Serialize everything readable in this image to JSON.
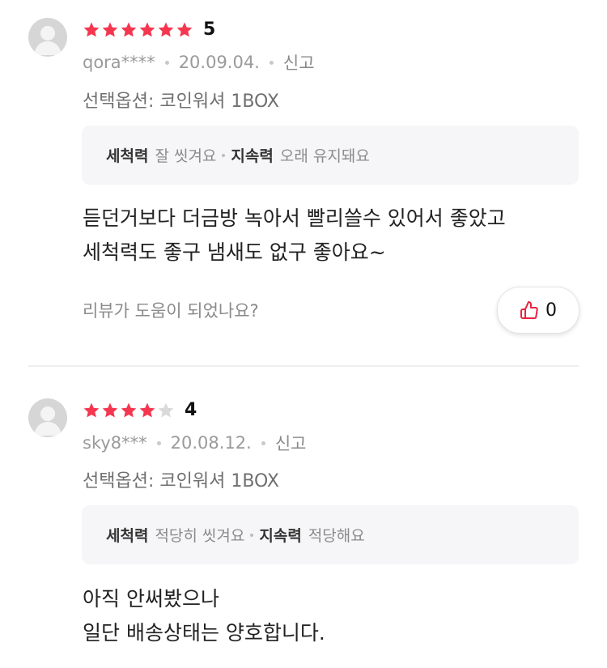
{
  "reviews": [
    {
      "rating": 5,
      "score_label": "5",
      "user": "qora****",
      "date": "20.09.04.",
      "report_label": "신고",
      "option": "선택옵션: 코인워셔 1BOX",
      "attributes": [
        {
          "name": "세척력",
          "value": "잘 씻겨요"
        },
        {
          "name": "지속력",
          "value": "오래 유지돼요"
        }
      ],
      "body": [
        "듣던거보다 더금방 녹아서 빨리쓸수 있어서 좋았고",
        "세척력도 좋구 냄새도 없구 좋아요~"
      ],
      "helpful_question": "리뷰가 도움이 되었나요?",
      "like_count": "0"
    },
    {
      "rating": 4,
      "score_label": "4",
      "user": "sky8***",
      "date": "20.08.12.",
      "report_label": "신고",
      "option": "선택옵션: 코인워셔 1BOX",
      "attributes": [
        {
          "name": "세척력",
          "value": "적당히 씻겨요"
        },
        {
          "name": "지속력",
          "value": "적당해요"
        }
      ],
      "body": [
        "아직 안써봤으나",
        "일단 배송상태는 양호합니다."
      ]
    }
  ],
  "colors": {
    "star_filled": "#f5364f",
    "star_empty": "#d9d9d9",
    "like_icon": "#e8233f"
  }
}
